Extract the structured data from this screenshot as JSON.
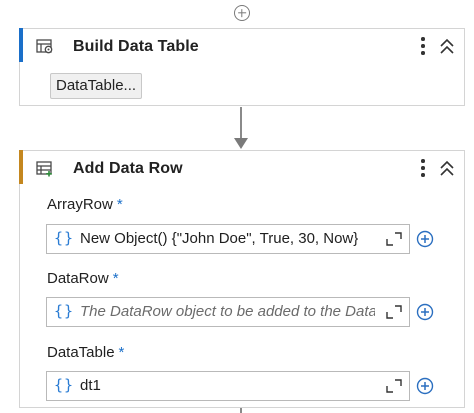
{
  "build_activity": {
    "title": "Build Data Table",
    "chip_label": "DataTable...",
    "accent_color": "#1a6fc9",
    "icon": "build-data-table-icon"
  },
  "add_activity": {
    "title": "Add Data Row",
    "accent_color": "#c4871f",
    "icon": "add-data-row-icon",
    "fields": [
      {
        "label": "ArrayRow",
        "required_mark": "*",
        "value": "New Object() {\"John Doe\", True, 30, Now}",
        "placeholder": ""
      },
      {
        "label": "DataRow",
        "required_mark": "*",
        "value": "",
        "placeholder": "The DataRow object to be added to the DataTable"
      },
      {
        "label": "DataTable",
        "required_mark": "*",
        "value": "dt1",
        "placeholder": ""
      }
    ]
  },
  "expression_marker": "{}",
  "icons": [
    "add-activity-icon",
    "more-options-icon",
    "collapse-icon",
    "expand-editor-icon",
    "add-variable-icon",
    "arrow-down-icon"
  ]
}
